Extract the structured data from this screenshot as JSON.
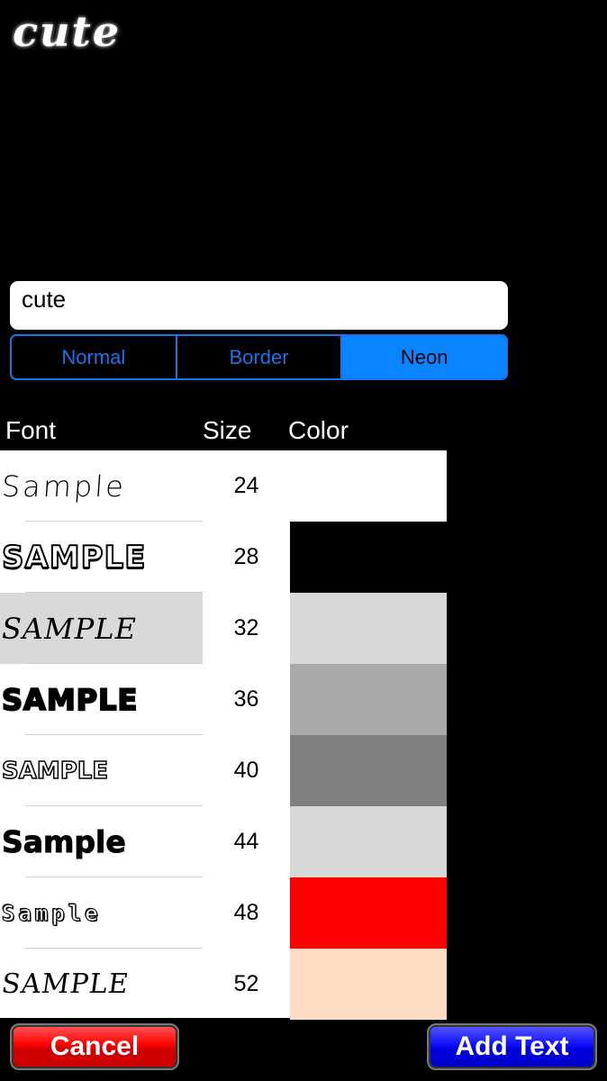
{
  "preview": {
    "text": "cute"
  },
  "input": {
    "value": "cute"
  },
  "segments": [
    {
      "label": "Normal",
      "selected": false
    },
    {
      "label": "Border",
      "selected": false
    },
    {
      "label": "Neon",
      "selected": true
    }
  ],
  "headers": {
    "font": "Font",
    "size": "Size",
    "color": "Color"
  },
  "fonts": [
    {
      "label": "Sample",
      "style": "handwritten"
    },
    {
      "label": "SAMPLE",
      "style": "outlined-bold"
    },
    {
      "label": "SAMPLE",
      "style": "brush",
      "selected": true
    },
    {
      "label": "SAMPLE",
      "style": "bubble"
    },
    {
      "label": "SAMPLE",
      "style": "outline-bubble"
    },
    {
      "label": "Sample",
      "style": "rounded-bold"
    },
    {
      "label": "Sample",
      "style": "decorative-circles"
    },
    {
      "label": "SAMPLE",
      "style": "scratchy"
    }
  ],
  "sizes": [
    "24",
    "28",
    "32",
    "36",
    "40",
    "44",
    "48",
    "52"
  ],
  "colors": [
    "#ffffff",
    "#000000",
    "#d8d8d8",
    "#a9a9a9",
    "#808080",
    "#d8d8d8",
    "#ff0000",
    "#ffdcc4"
  ],
  "buttons": {
    "cancel": "Cancel",
    "add": "Add Text"
  }
}
